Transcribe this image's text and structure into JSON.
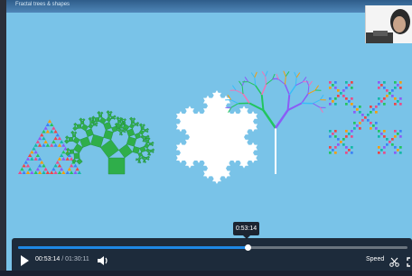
{
  "window": {
    "tab_title": "Fractal trees & shapes"
  },
  "player": {
    "current_time": "00:53:14",
    "separator": " / ",
    "duration": "01:30:11",
    "tooltip_time": "0:53:14",
    "progress": 0.59,
    "speed_label": "Speed"
  },
  "colors": {
    "background": "#79c3e8",
    "sierpinski": [
      "#e84d8a",
      "#3b82f6",
      "#22c55e",
      "#f59e0b",
      "#8b5cf6",
      "#14b8a6",
      "#ef4444"
    ],
    "pythagoras": "#2fae4a",
    "koch": "#ffffff",
    "tree_trunk": "#ffffff",
    "tree_branches": [
      "#22c55e",
      "#8b5cf6",
      "#f472b6",
      "#38bdf8",
      "#f59e0b"
    ],
    "accent": "#1e88e5"
  },
  "icons": {
    "play": "play-icon",
    "volume": "speaker-icon",
    "clip": "scissors-icon",
    "fullscreen": "fullscreen-icon"
  }
}
